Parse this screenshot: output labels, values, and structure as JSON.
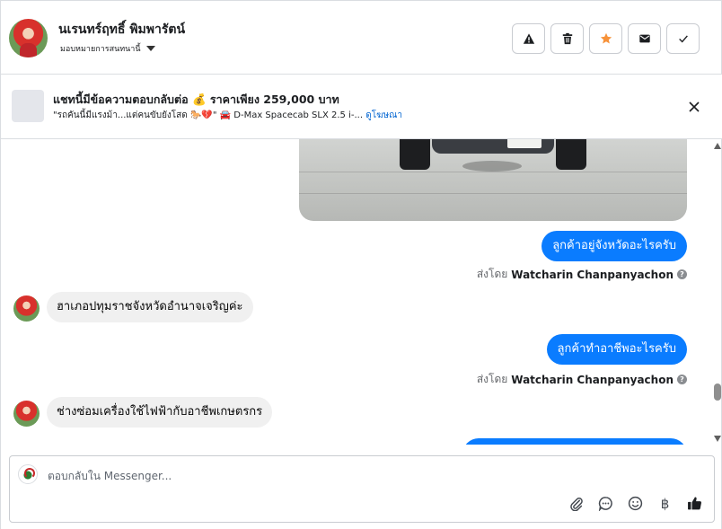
{
  "header": {
    "contact_name": "นเรนทร์ฤทธิ์ พิมพารัตน์",
    "assign_label": "มอบหมายการสนทนานี้",
    "actions": [
      {
        "name": "mark-spam-button",
        "icon": "warning-icon"
      },
      {
        "name": "delete-button",
        "icon": "trash-icon"
      },
      {
        "name": "star-button",
        "icon": "star-icon"
      },
      {
        "name": "mark-unread-button",
        "icon": "envelope-icon"
      },
      {
        "name": "mark-done-button",
        "icon": "check-icon"
      }
    ]
  },
  "banner": {
    "title": "แชทนี้มีข้อความตอบกลับต่อ 💰 ราคาเพียง 259,000 บาท",
    "subtitle": "\"รถคันนี้มีแรงม้า...แต่คนขับยังโสด 🐎💔\" 🚘 D-Max Spacecab SLX 2.5 i-...",
    "link": "ดูโฆษณา"
  },
  "messages": [
    {
      "type": "out",
      "text": "ลูกค้าอยู่จังหวัดอะไรครับ"
    },
    {
      "type": "sent_by",
      "prefix": "ส่งโดย",
      "sender": "Watcharin Chanpanyachon"
    },
    {
      "type": "in",
      "text": "ฮาเภอปทุมราชจังหวัดอำนาจเจริญค่ะ"
    },
    {
      "type": "out",
      "text": "ลูกค้าทำอาชีพอะไรครับ"
    },
    {
      "type": "sent_by",
      "prefix": "ส่งโดย",
      "sender": "Watcharin Chanpanyachon"
    },
    {
      "type": "in",
      "text": "ช่างซ่อมเครื่องใช้ไฟฟ้ากับอาชีพเกษตรกร"
    }
  ],
  "composer": {
    "placeholder": "ตอบกลับใน Messenger...",
    "tools": [
      "paperclip-icon",
      "chat-bubble-icon",
      "emoji-icon",
      "baht-icon",
      "thumbs-up-icon"
    ],
    "baht_symbol": "฿"
  },
  "colors": {
    "accent": "#0a7cff",
    "star": "#f7923a",
    "link": "#0064d1"
  }
}
